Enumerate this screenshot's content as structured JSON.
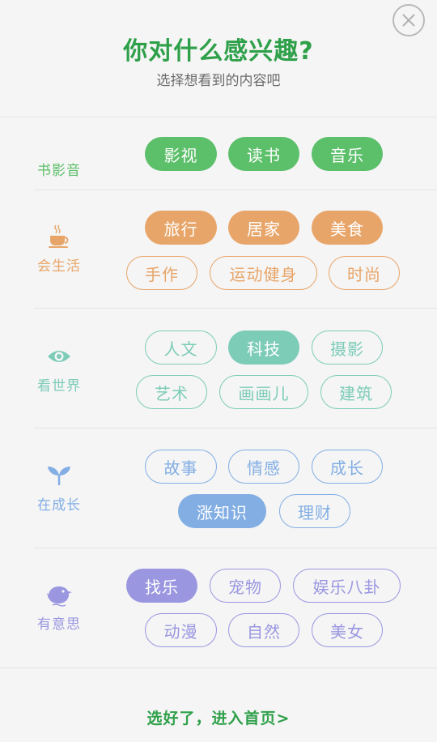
{
  "header": {
    "title": "你对什么感兴趣?",
    "subtitle": "选择想看到的内容吧",
    "close_icon": "close-icon"
  },
  "sections": [
    {
      "label": "书影音",
      "icon": "",
      "color": "#5cbf6a",
      "rows": [
        [
          {
            "label": "影视",
            "selected": true
          },
          {
            "label": "读书",
            "selected": true
          },
          {
            "label": "音乐",
            "selected": true
          }
        ]
      ]
    },
    {
      "label": "会生活",
      "icon": "coffee-cup-icon",
      "color": "#e8a569",
      "rows": [
        [
          {
            "label": "旅行",
            "selected": true
          },
          {
            "label": "居家",
            "selected": true
          },
          {
            "label": "美食",
            "selected": true
          }
        ],
        [
          {
            "label": "手作",
            "selected": false
          },
          {
            "label": "运动健身",
            "selected": false
          },
          {
            "label": "时尚",
            "selected": false
          }
        ]
      ]
    },
    {
      "label": "看世界",
      "icon": "eye-icon",
      "color": "#7dccb8",
      "rows": [
        [
          {
            "label": "人文",
            "selected": false
          },
          {
            "label": "科技",
            "selected": true
          },
          {
            "label": "摄影",
            "selected": false
          }
        ],
        [
          {
            "label": "艺术",
            "selected": false
          },
          {
            "label": "画画儿",
            "selected": false
          },
          {
            "label": "建筑",
            "selected": false
          }
        ]
      ]
    },
    {
      "label": "在成长",
      "icon": "sprout-icon",
      "color": "#82aee4",
      "rows": [
        [
          {
            "label": "故事",
            "selected": false
          },
          {
            "label": "情感",
            "selected": false
          },
          {
            "label": "成长",
            "selected": false
          }
        ],
        [
          {
            "label": "涨知识",
            "selected": true
          },
          {
            "label": "理财",
            "selected": false
          }
        ]
      ]
    },
    {
      "label": "有意思",
      "icon": "bird-icon",
      "color": "#9a97e0",
      "rows": [
        [
          {
            "label": "找乐",
            "selected": true
          },
          {
            "label": "宠物",
            "selected": false
          },
          {
            "label": "娱乐八卦",
            "selected": false
          }
        ],
        [
          {
            "label": "动漫",
            "selected": false
          },
          {
            "label": "自然",
            "selected": false
          },
          {
            "label": "美女",
            "selected": false
          }
        ]
      ]
    }
  ],
  "footer": {
    "cta": "选好了，进入首页>"
  }
}
